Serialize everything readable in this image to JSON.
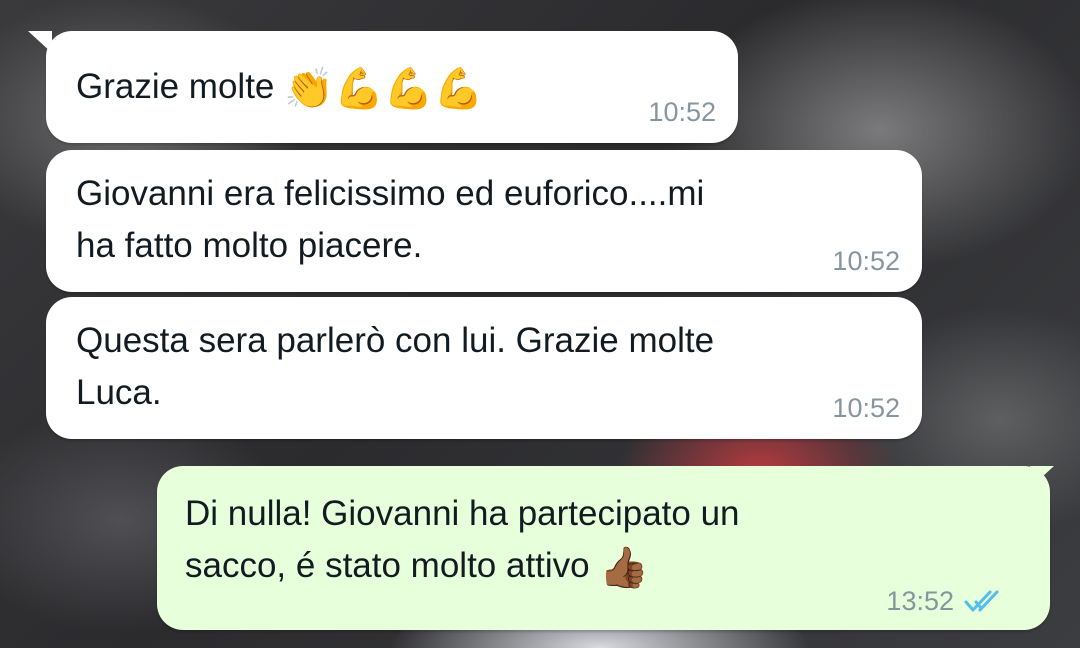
{
  "messages": [
    {
      "direction": "incoming",
      "lines": [
        "Grazie molte"
      ],
      "emoji": [
        "👏",
        "💪",
        "💪",
        "💪"
      ],
      "time": "10:52"
    },
    {
      "direction": "incoming",
      "lines": [
        "Giovanni era felicissimo ed euforico....mi",
        "ha fatto molto piacere."
      ],
      "time": "10:52"
    },
    {
      "direction": "incoming",
      "lines": [
        "Questa sera parlerò con lui. Grazie molte",
        "Luca."
      ],
      "time": "10:52"
    },
    {
      "direction": "outgoing",
      "lines": [
        "Di nulla! Giovanni ha partecipato un",
        "sacco, é stato molto attivo"
      ],
      "emoji": [
        "👍🏾"
      ],
      "time": "13:52",
      "status": "read"
    }
  ],
  "colors": {
    "incoming_bubble": "#ffffff",
    "outgoing_bubble": "#e7ffdb",
    "read_ticks": "#53bdeb",
    "timestamp": "#8696a0"
  },
  "icons": {
    "read_receipt": "double-check-icon"
  }
}
